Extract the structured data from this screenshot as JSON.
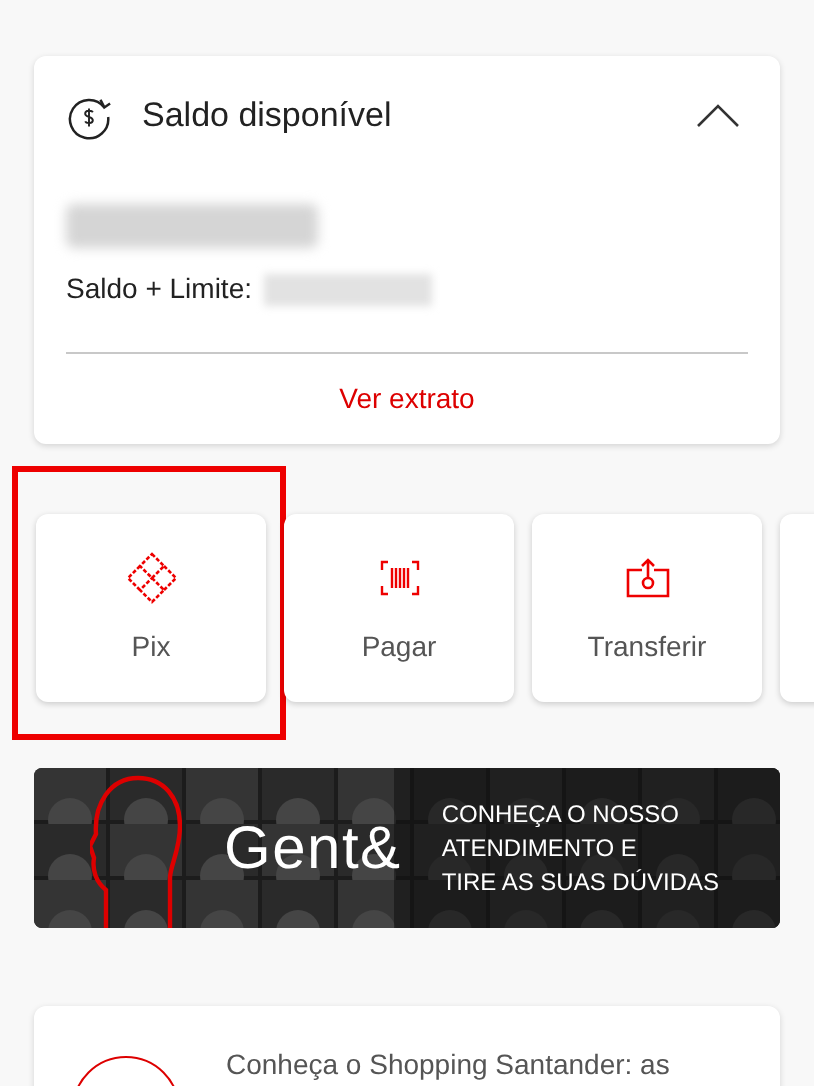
{
  "balance_card": {
    "title": "Saldo disponível",
    "expanded": true,
    "balance_hidden": true,
    "limit_label": "Saldo + Limite:",
    "limit_hidden": true,
    "link": "Ver extrato"
  },
  "actions": [
    {
      "kind": "pix",
      "label": "Pix",
      "highlighted": true
    },
    {
      "kind": "pay",
      "label": "Pagar",
      "highlighted": false
    },
    {
      "kind": "transfer",
      "label": "Transferir",
      "highlighted": false
    },
    {
      "kind": "partial",
      "highlighted": false
    }
  ],
  "banner": {
    "logo": "Gent&",
    "lines": [
      "CONHEÇA O NOSSO",
      "ATENDIMENTO E",
      "TIRE AS SUAS DÚVIDAS"
    ]
  },
  "promo_card": {
    "text": "Conheça o Shopping Santander: as"
  }
}
